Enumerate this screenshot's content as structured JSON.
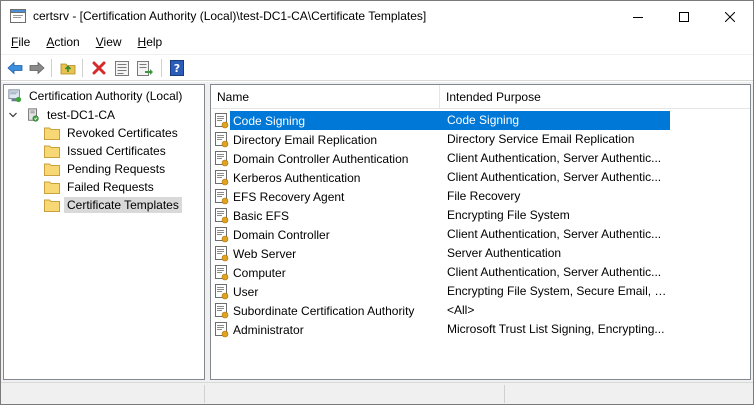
{
  "window": {
    "title": "certsrv - [Certification Authority (Local)\\test-DC1-CA\\Certificate Templates]"
  },
  "menu": {
    "items": [
      {
        "label": "File",
        "accel": "F",
        "rest": "ile"
      },
      {
        "label": "Action",
        "accel": "A",
        "rest": "ction"
      },
      {
        "label": "View",
        "accel": "V",
        "rest": "iew"
      },
      {
        "label": "Help",
        "accel": "H",
        "rest": "elp"
      }
    ]
  },
  "toolbar": {
    "buttons": [
      "back-icon",
      "forward-icon",
      "up-folder-icon",
      "delete-icon",
      "properties-icon",
      "export-list-icon",
      "help-icon"
    ]
  },
  "tree": {
    "root": "Certification Authority (Local)",
    "ca": "test-DC1-CA",
    "folders": [
      "Revoked Certificates",
      "Issued Certificates",
      "Pending Requests",
      "Failed Requests",
      "Certificate Templates"
    ],
    "selected_folder": "Certificate Templates"
  },
  "list": {
    "columns": [
      "Name",
      "Intended Purpose"
    ],
    "rows": [
      {
        "name": "Code Signing",
        "purpose": "Code Signing"
      },
      {
        "name": "Directory Email Replication",
        "purpose": "Directory Service Email Replication"
      },
      {
        "name": "Domain Controller Authentication",
        "purpose": "Client Authentication, Server Authentic..."
      },
      {
        "name": "Kerberos Authentication",
        "purpose": "Client Authentication, Server Authentic..."
      },
      {
        "name": "EFS Recovery Agent",
        "purpose": "File Recovery"
      },
      {
        "name": "Basic EFS",
        "purpose": "Encrypting File System"
      },
      {
        "name": "Domain Controller",
        "purpose": "Client Authentication, Server Authentic..."
      },
      {
        "name": "Web Server",
        "purpose": "Server Authentication"
      },
      {
        "name": "Computer",
        "purpose": "Client Authentication, Server Authentic..."
      },
      {
        "name": "User",
        "purpose": "Encrypting File System, Secure Email, Cl..."
      },
      {
        "name": "Subordinate Certification Authority",
        "purpose": "<All>"
      },
      {
        "name": "Administrator",
        "purpose": "Microsoft Trust List Signing, Encrypting..."
      }
    ],
    "selected_row": "Code Signing"
  },
  "colors": {
    "selection": "#0078d7",
    "tree_selection": "#d9d9d9",
    "folder": "#f8d775",
    "delete": "#d62b2b"
  }
}
